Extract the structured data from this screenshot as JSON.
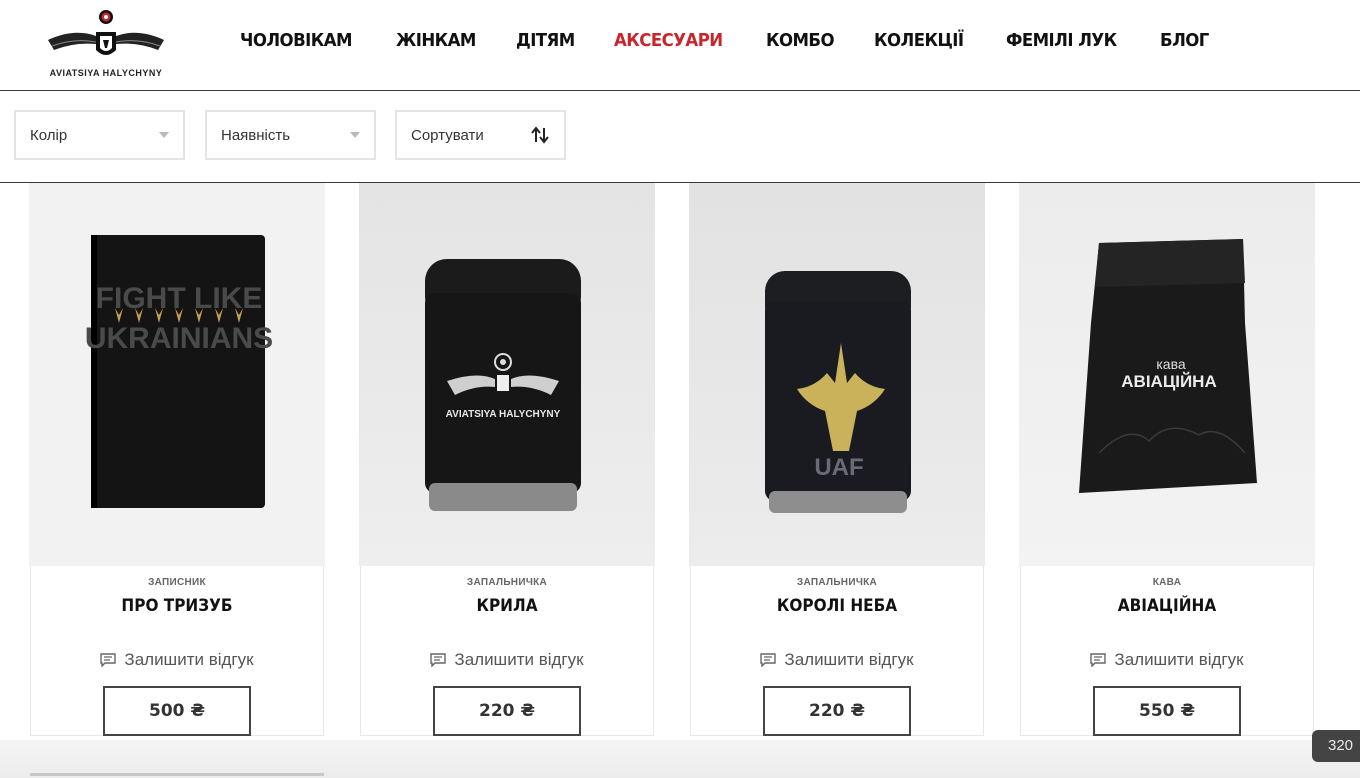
{
  "brand": {
    "logo_text": "AVIATSIYA HALYCHYNY"
  },
  "nav": {
    "items": [
      {
        "label": "ЧОЛОВІКАМ"
      },
      {
        "label": "ЖІНКАМ"
      },
      {
        "label": "ДІТЯМ"
      },
      {
        "label": "АКСЕСУАРИ"
      },
      {
        "label": "КОМБО"
      },
      {
        "label": "КОЛЕКЦІЇ"
      },
      {
        "label": "ФЕМІЛІ ЛУК"
      },
      {
        "label": "БЛОГ"
      }
    ],
    "active_label": "АКСЕСУАРИ",
    "active_color": "#c8262d"
  },
  "filters": {
    "color": "Колір",
    "availability": "Наявність",
    "sort": "Сортувати"
  },
  "products": [
    {
      "category": "ЗАПИСНИК",
      "title": "ПРО ТРИЗУБ",
      "review": "Залишити відгук",
      "price": "500 ₴",
      "image_text_1": "FIGHT LIKE",
      "image_text_2": "UKRAINIANS"
    },
    {
      "category": "ЗАПАЛЬНИЧКА",
      "title": "КРИЛА",
      "review": "Залишити відгук",
      "price": "220 ₴",
      "image_text": "AVIATSIYA HALYCHYNY"
    },
    {
      "category": "ЗАПАЛЬНИЧКА",
      "title": "КОРОЛІ НЕБА",
      "review": "Залишити відгук",
      "price": "220 ₴",
      "image_text": "UAF"
    },
    {
      "category": "КАВА",
      "title": "АВІАЦІЙНА",
      "review": "Залишити відгук",
      "price": "550 ₴",
      "image_text_1": "кава",
      "image_text_2": "АВІАЦІЙНА"
    }
  ],
  "floating_tag": "320"
}
